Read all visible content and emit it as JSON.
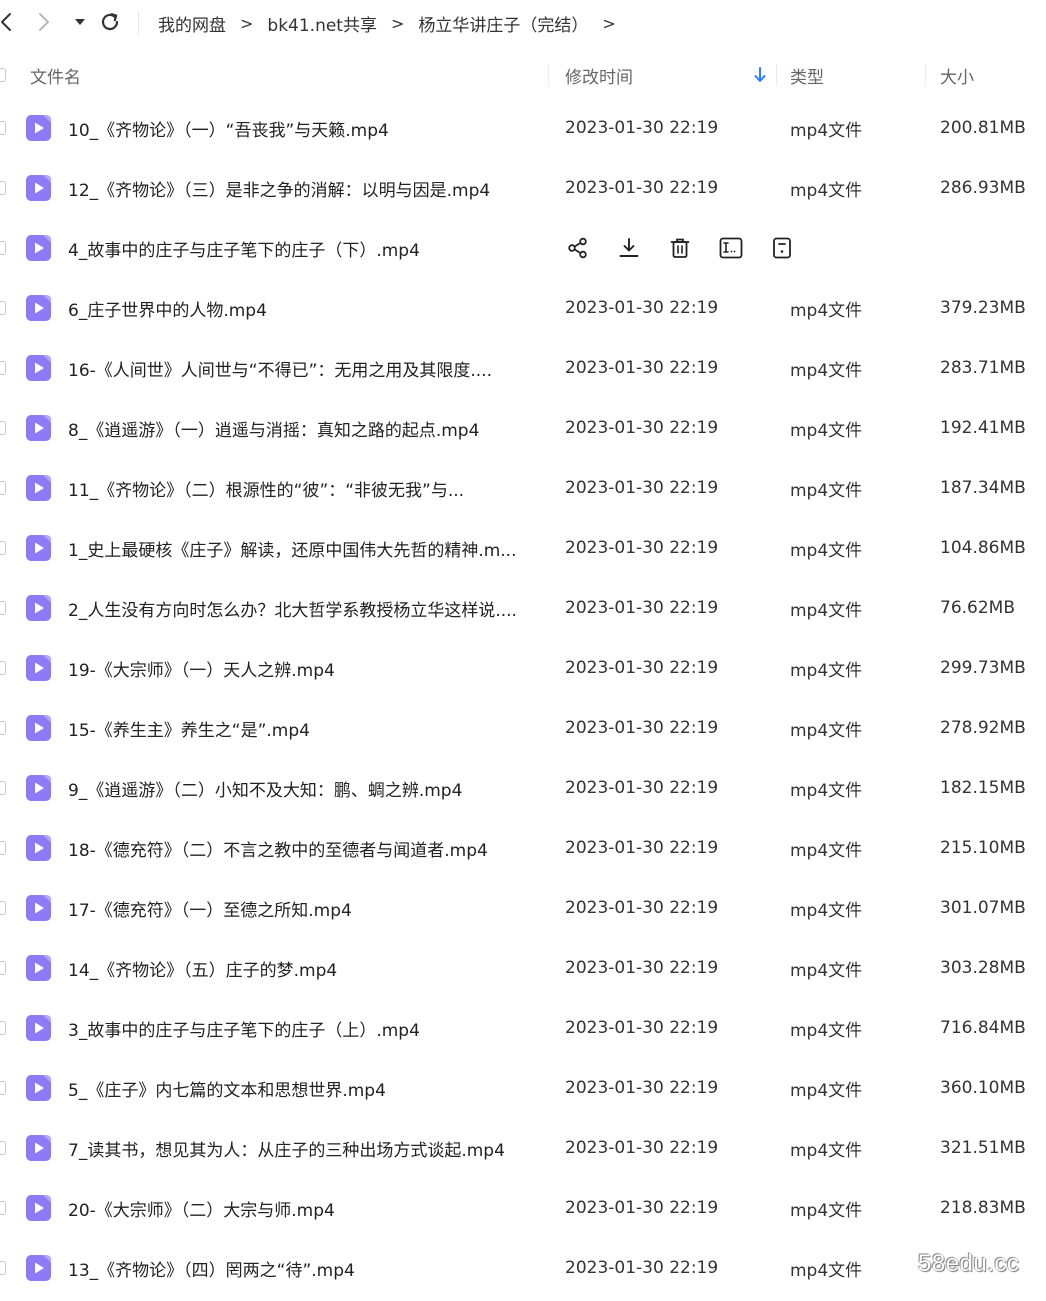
{
  "nav": {
    "back_icon": "chevron-left-icon",
    "forward_icon": "chevron-right-icon",
    "dropdown_icon": "caret-down-icon",
    "refresh_icon": "refresh-icon"
  },
  "breadcrumb": {
    "items": [
      "我的网盘",
      "bk41.net共享",
      "杨立华讲庄子（完结）"
    ],
    "separator": ">"
  },
  "columns": {
    "name": "文件名",
    "modified": "修改时间",
    "type": "类型",
    "size": "大小"
  },
  "sort": {
    "column": "修改时间",
    "direction": "descending",
    "icon": "arrow-down-icon",
    "color": "#2b7fff"
  },
  "colors": {
    "file_icon": "#8d7bf5",
    "file_icon_light": "#b4a6ff"
  },
  "hover_actions": [
    "share-icon",
    "download-icon",
    "delete-icon",
    "rename-icon",
    "more-icon"
  ],
  "files": [
    {
      "name": "10_《齐物论》（一）“吾丧我”与天籁.mp4",
      "modified": "2023-01-30 22:19",
      "type": "mp4文件",
      "size": "200.81MB"
    },
    {
      "name": "12_《齐物论》（三）是非之争的消解：以明与因是.mp4",
      "modified": "2023-01-30 22:19",
      "type": "mp4文件",
      "size": "286.93MB"
    },
    {
      "name": "4_故事中的庄子与庄子笔下的庄子（下）.mp4",
      "modified": "",
      "type": "",
      "size": "",
      "hovered": true
    },
    {
      "name": "6_庄子世界中的人物.mp4",
      "modified": "2023-01-30 22:19",
      "type": "mp4文件",
      "size": "379.23MB"
    },
    {
      "name": "16-《人间世》人间世与“不得已”：无用之用及其限度....",
      "modified": "2023-01-30 22:19",
      "type": "mp4文件",
      "size": "283.71MB"
    },
    {
      "name": "8_《逍遥游》（一）逍遥与消摇：真知之路的起点.mp4",
      "modified": "2023-01-30 22:19",
      "type": "mp4文件",
      "size": "192.41MB"
    },
    {
      "name": "11_《齐物论》（二）根源性的“彼”：“非彼无我”与...",
      "modified": "2023-01-30 22:19",
      "type": "mp4文件",
      "size": "187.34MB"
    },
    {
      "name": "1_史上最硬核《庄子》解读，还原中国伟大先哲的精神.m...",
      "modified": "2023-01-30 22:19",
      "type": "mp4文件",
      "size": "104.86MB"
    },
    {
      "name": "2_人生没有方向时怎么办？北大哲学系教授杨立华这样说....",
      "modified": "2023-01-30 22:19",
      "type": "mp4文件",
      "size": "76.62MB"
    },
    {
      "name": "19-《大宗师》（一）天人之辨.mp4",
      "modified": "2023-01-30 22:19",
      "type": "mp4文件",
      "size": "299.73MB"
    },
    {
      "name": "15-《养生主》养生之“是”.mp4",
      "modified": "2023-01-30 22:19",
      "type": "mp4文件",
      "size": "278.92MB"
    },
    {
      "name": "9_《逍遥游》（二）小知不及大知：鹏、蜩之辨.mp4",
      "modified": "2023-01-30 22:19",
      "type": "mp4文件",
      "size": "182.15MB"
    },
    {
      "name": "18-《德充符》（二）不言之教中的至德者与闻道者.mp4",
      "modified": "2023-01-30 22:19",
      "type": "mp4文件",
      "size": "215.10MB"
    },
    {
      "name": "17-《德充符》（一）至德之所知.mp4",
      "modified": "2023-01-30 22:19",
      "type": "mp4文件",
      "size": "301.07MB"
    },
    {
      "name": "14_《齐物论》（五）庄子的梦.mp4",
      "modified": "2023-01-30 22:19",
      "type": "mp4文件",
      "size": "303.28MB"
    },
    {
      "name": "3_故事中的庄子与庄子笔下的庄子（上）.mp4",
      "modified": "2023-01-30 22:19",
      "type": "mp4文件",
      "size": "716.84MB"
    },
    {
      "name": "5_《庄子》内七篇的文本和思想世界.mp4",
      "modified": "2023-01-30 22:19",
      "type": "mp4文件",
      "size": "360.10MB"
    },
    {
      "name": "7_读其书，想见其为人：从庄子的三种出场方式谈起.mp4",
      "modified": "2023-01-30 22:19",
      "type": "mp4文件",
      "size": "321.51MB"
    },
    {
      "name": "20-《大宗师》（二）大宗与师.mp4",
      "modified": "2023-01-30 22:19",
      "type": "mp4文件",
      "size": "218.83MB"
    },
    {
      "name": "13_《齐物论》（四）罔两之“待”.mp4",
      "modified": "2023-01-30 22:19",
      "type": "mp4文件",
      "size": ""
    }
  ],
  "watermark": "58edu.cc"
}
